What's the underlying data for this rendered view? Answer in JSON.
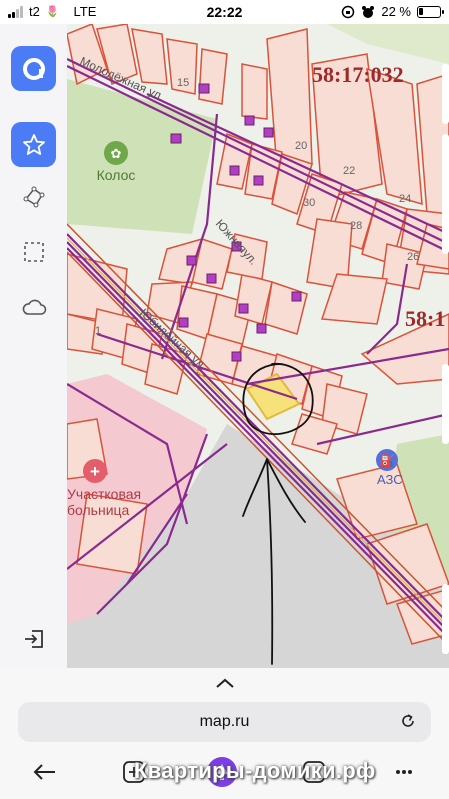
{
  "status_bar": {
    "carrier": "t2",
    "carrier_emoji": "🌷",
    "network": "LTE",
    "time": "22:22",
    "battery_percent_label": "22 %",
    "battery_level": 0.22
  },
  "toolbar": {
    "items": [
      {
        "icon": "map-app-logo-icon"
      },
      {
        "icon": "star-icon"
      },
      {
        "icon": "polyline-tool-icon"
      },
      {
        "icon": "select-area-icon"
      },
      {
        "icon": "cloud-icon"
      },
      {
        "icon": "exit-icon"
      }
    ]
  },
  "map": {
    "cadastral_code_1": "58:17:032",
    "cadastral_code_2": "58:1",
    "poi_kolos": "Колос",
    "poi_hospital_line1": "Участковая",
    "poi_hospital_line2": "больница",
    "poi_gas": "АЗС",
    "street_1": "Молодёжная ул.",
    "street_2": "Южнаяул.",
    "street_3": "Юбилейная ул.",
    "plot_numbers": [
      "15",
      "20",
      "22",
      "24",
      "30",
      "28",
      "26",
      "1"
    ],
    "colors": {
      "plot_border": "#d9533b",
      "plot_fill": "#f7ded6",
      "utility_line": "#8a2a8f",
      "highlight": "#f7e27a",
      "green_area": "#cfe3b4",
      "hospital_area": "#f3c9cf",
      "grey_area": "#d9d9d9",
      "cadastral_text": "#9c2a2a"
    }
  },
  "browser": {
    "url": "map.ru"
  },
  "watermark": "Квартиры-домики.рф"
}
